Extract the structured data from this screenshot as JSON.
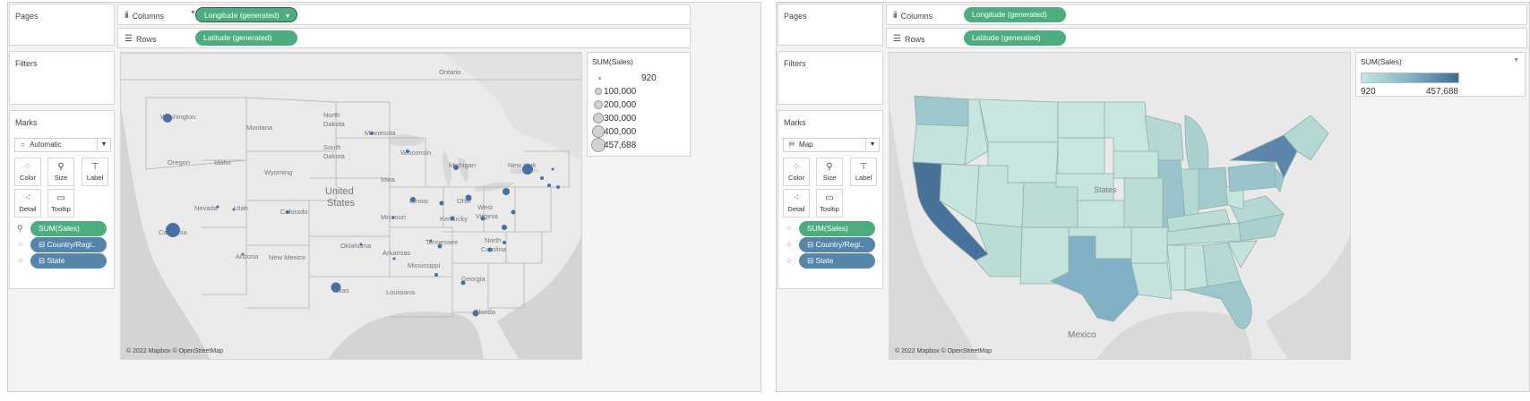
{
  "left": {
    "pages_label": "Pages",
    "filters_label": "Filters",
    "marks_label": "Marks",
    "columns_label": "Columns",
    "rows_label": "Rows",
    "columns_pill": "Longitude (generated)",
    "rows_pill": "Latitude (generated)",
    "mark_type": "Automatic",
    "mark_buttons": [
      "Color",
      "Size",
      "Label",
      "Detail",
      "Tooltip"
    ],
    "mark_pills": [
      "SUM(Sales)",
      "Country/Regi..",
      "State"
    ],
    "attribution": "© 2022 Mapbox © OpenStreetMap",
    "legend": {
      "title": "SUM(Sales)",
      "values": [
        "920",
        "100,000",
        "200,000",
        "300,000",
        "400,000",
        "457,688"
      ]
    },
    "map_labels": {
      "washington": "Washington",
      "oregon": "Oregon",
      "idaho": "Idaho",
      "montana": "Montana",
      "wyoming": "Wyoming",
      "nevada": "Nevada",
      "utah": "Utah",
      "colorado": "Colorado",
      "california": "California",
      "arizona": "Arizona",
      "new_mexico": "New Mexico",
      "north_dakota_1": "North",
      "north_dakota_2": "Dakota",
      "south_dakota_1": "South",
      "south_dakota_2": "Dakota",
      "minnesota": "Minnesota",
      "wisconsin": "Wisconsin",
      "iowa": "Iowa",
      "missouri": "Missouri",
      "oklahoma": "Oklahoma",
      "arkansas": "Arkansas",
      "texas": "Texas",
      "louisiana": "Louisiana",
      "mississippi": "Mississippi",
      "tennessee": "Tennessee",
      "kentucky": "Kentucky",
      "illinois": "Illinois",
      "ohio": "Ohio",
      "west_virginia_1": "West",
      "virginia": "Virginia",
      "north_carolina_1": "North",
      "north_carolina_2": "Carolina",
      "georgia": "Georgia",
      "florida": "Florida",
      "michigan": "Michigan",
      "new_york": "New York",
      "ontario": "Ontario",
      "united_1": "United",
      "united_2": "States"
    }
  },
  "right": {
    "pages_label": "Pages",
    "filters_label": "Filters",
    "marks_label": "Marks",
    "columns_label": "Columns",
    "rows_label": "Rows",
    "columns_pill": "Longitude (generated)",
    "rows_pill": "Latitude (generated)",
    "mark_type": "Map",
    "mark_buttons": [
      "Color",
      "Size",
      "Label",
      "Detail",
      "Tooltip"
    ],
    "mark_pills": [
      "SUM(Sales)",
      "Country/Regi..",
      "State"
    ],
    "attribution": "© 2022 Mapbox © OpenStreetMap",
    "legend": {
      "title": "SUM(Sales)",
      "min": "920",
      "max": "457,688"
    },
    "map_labels": {
      "mexico": "Mexico",
      "united_states": "States"
    }
  },
  "colors": {
    "green_pill": "#4cae7f",
    "blue_pill": "#5585a8",
    "symbol_blue": "#4a6fa5",
    "map_base": "#e6e6e6",
    "choropleth_low": "#c6e5df",
    "choropleth_high": "#3f6d93"
  }
}
